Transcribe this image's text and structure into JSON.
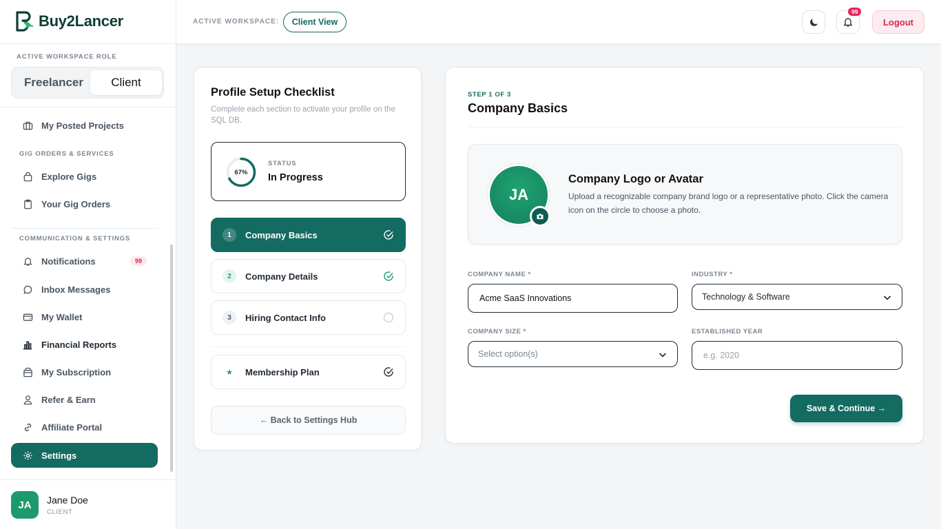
{
  "brand": {
    "name": "Buy2Lancer"
  },
  "sidebar": {
    "role_label": "ACTIVE WORKSPACE ROLE",
    "roles": {
      "freelancer": "Freelancer",
      "client": "Client"
    },
    "items": {
      "posted_projects": "My Posted Projects",
      "explore_gigs": "Explore Gigs",
      "gig_orders": "Your Gig Orders",
      "notifications": "Notifications",
      "notifications_badge": "99",
      "inbox": "Inbox Messages",
      "wallet": "My Wallet",
      "financial_reports": "Financial Reports",
      "subscription": "My Subscription",
      "refer": "Refer & Earn",
      "affiliate": "Affiliate Portal",
      "settings": "Settings"
    },
    "sections": {
      "gig": "GIG ORDERS & SERVICES",
      "comm": "COMMUNICATION & SETTINGS"
    },
    "user": {
      "initials": "JA",
      "name": "Jane Doe",
      "role": "CLIENT"
    }
  },
  "header": {
    "workspace_label": "ACTIVE WORKSPACE:",
    "workspace_value": "Client View",
    "bell_badge": "99",
    "logout": "Logout"
  },
  "checklist": {
    "title": "Profile Setup Checklist",
    "subtitle": "Complete each section to activate your profile on the SQL DB.",
    "progress_percent": 67,
    "progress_text": "67%",
    "status_label": "STATUS",
    "status_value": "In Progress",
    "steps": [
      {
        "num": "1",
        "label": "Company Basics"
      },
      {
        "num": "2",
        "label": "Company Details"
      },
      {
        "num": "3",
        "label": "Hiring Contact Info"
      }
    ],
    "membership": {
      "icon": "★",
      "label": "Membership Plan"
    },
    "back": "← Back to Settings Hub"
  },
  "form": {
    "step_of": "STEP 1 OF 3",
    "title": "Company Basics",
    "logo": {
      "initials": "JA",
      "title": "Company Logo or Avatar",
      "description": "Upload a recognizable company brand logo or a representative photo. Click the camera icon on the circle to choose a photo."
    },
    "fields": {
      "company_name_label": "COMPANY NAME *",
      "company_name_value": "Acme SaaS Innovations",
      "industry_label": "INDUSTRY *",
      "industry_value": "Technology & Software",
      "company_size_label": "COMPANY SIZE *",
      "company_size_placeholder": "Select option(s)",
      "established_label": "ESTABLISHED YEAR",
      "established_placeholder": "e.g. 2020"
    },
    "save": "Save & Continue →"
  },
  "colors": {
    "accent": "#136b61",
    "brand_green": "#1d9a6c",
    "danger": "#e0244a"
  }
}
